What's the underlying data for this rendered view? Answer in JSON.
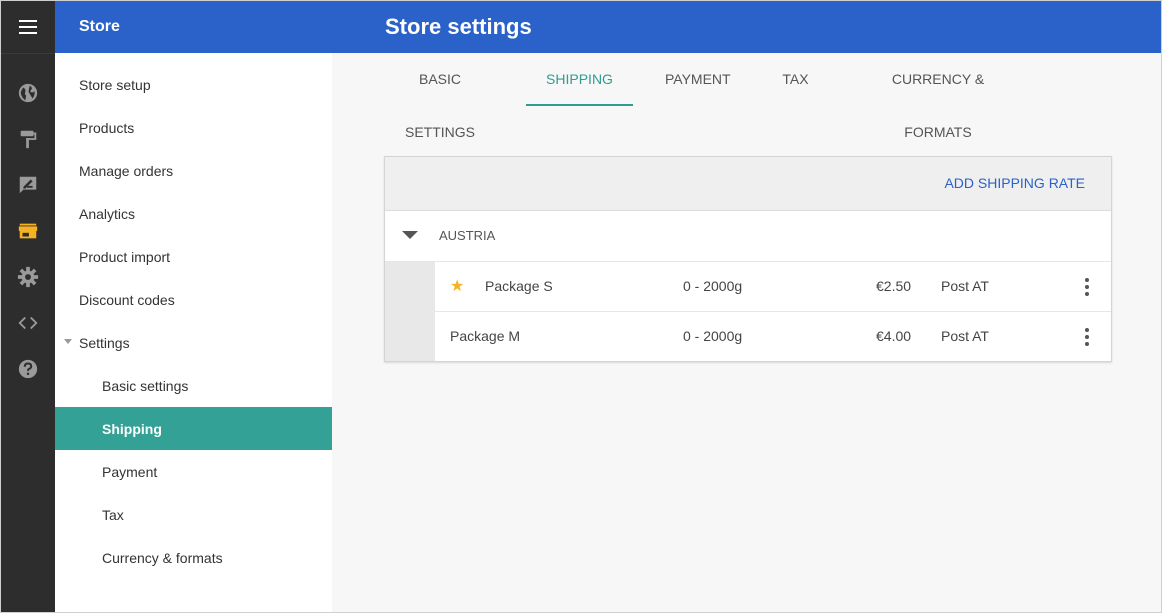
{
  "rail": {
    "icons": [
      "menu-icon",
      "globe-icon",
      "paint-roller-icon",
      "design-icon",
      "store-icon",
      "gear-icon",
      "code-icon",
      "help-icon"
    ],
    "active_color": "#f5b324"
  },
  "nav": {
    "header": "Store",
    "items": [
      {
        "label": "Store setup"
      },
      {
        "label": "Products"
      },
      {
        "label": "Manage orders"
      },
      {
        "label": "Analytics"
      },
      {
        "label": "Product import"
      },
      {
        "label": "Discount codes"
      },
      {
        "label": "Settings"
      }
    ],
    "sub_items": [
      {
        "label": "Basic settings"
      },
      {
        "label": "Shipping",
        "active": true
      },
      {
        "label": "Payment"
      },
      {
        "label": "Tax"
      },
      {
        "label": "Currency & formats"
      }
    ]
  },
  "main": {
    "title": "Store settings",
    "tabs": [
      {
        "label": "BASIC SETTINGS"
      },
      {
        "label": "SHIPPING",
        "active": true
      },
      {
        "label": "PAYMENT"
      },
      {
        "label": "TAX"
      },
      {
        "label": "CURRENCY & FORMATS"
      }
    ],
    "shipping": {
      "add_label": "ADD SHIPPING RATE",
      "group": "AUSTRIA",
      "rates": [
        {
          "name": "Package S",
          "weight": "0 - 2000g",
          "price": "€2.50",
          "carrier": "Post AT",
          "default": true
        },
        {
          "name": "Package M",
          "weight": "0 - 2000g",
          "price": "€4.00",
          "carrier": "Post AT",
          "default": false
        }
      ]
    }
  },
  "colors": {
    "header_blue": "#2a62c9",
    "accent_teal": "#33a195",
    "tab_teal": "#2f9d90",
    "rail_dark": "#2d2d2d"
  }
}
